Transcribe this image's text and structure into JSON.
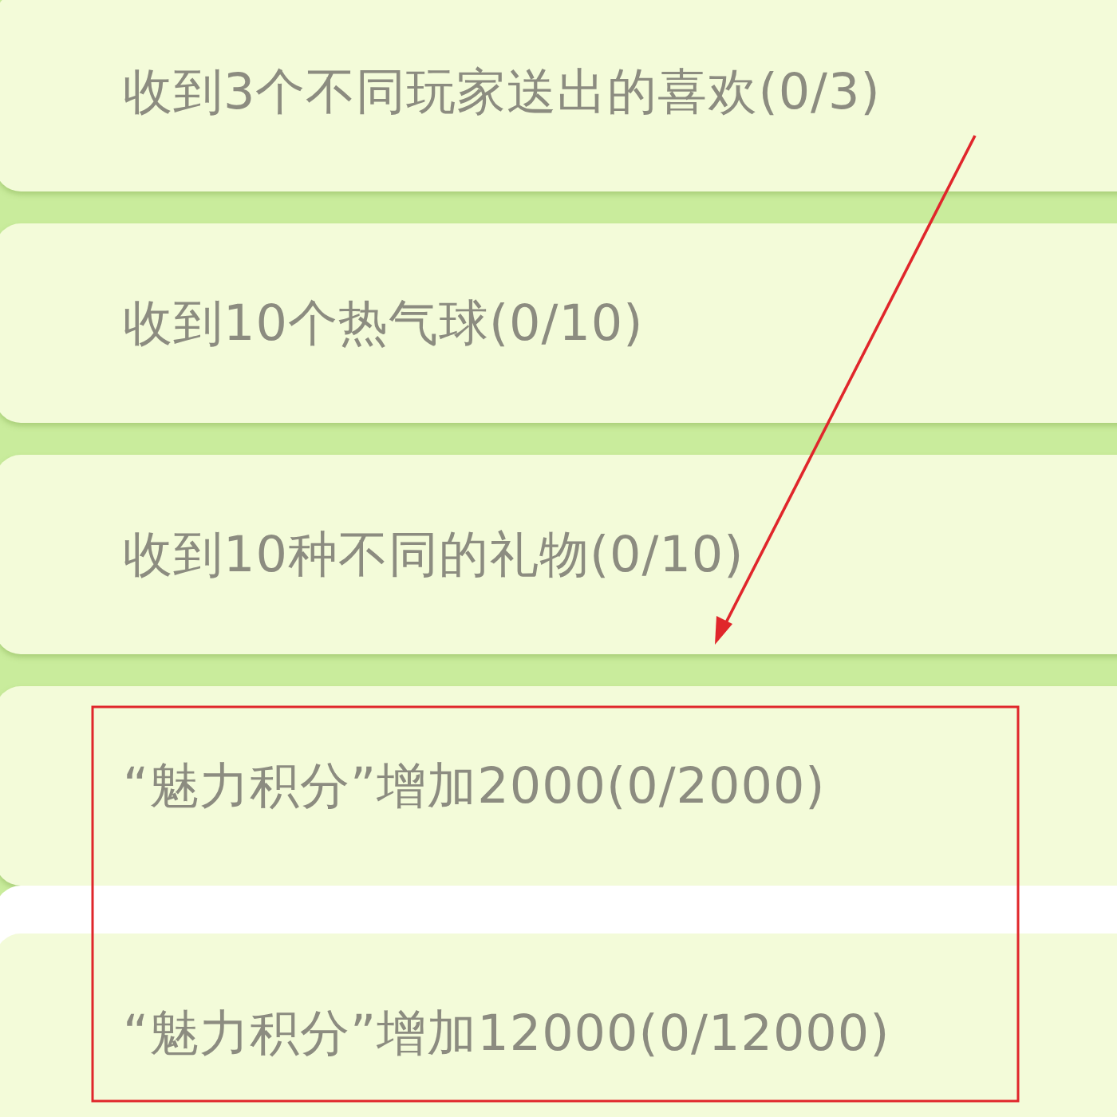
{
  "tasks": [
    {
      "text": "收到3个不同玩家送出的喜欢(0/3)"
    },
    {
      "text": "收到10个热气球(0/10)"
    },
    {
      "text": "收到10种不同的礼物(0/10)"
    },
    {
      "text": "“魅力积分”增加2000(0/2000)"
    },
    {
      "text": "“魅力积分”增加12000(0/12000)"
    }
  ]
}
